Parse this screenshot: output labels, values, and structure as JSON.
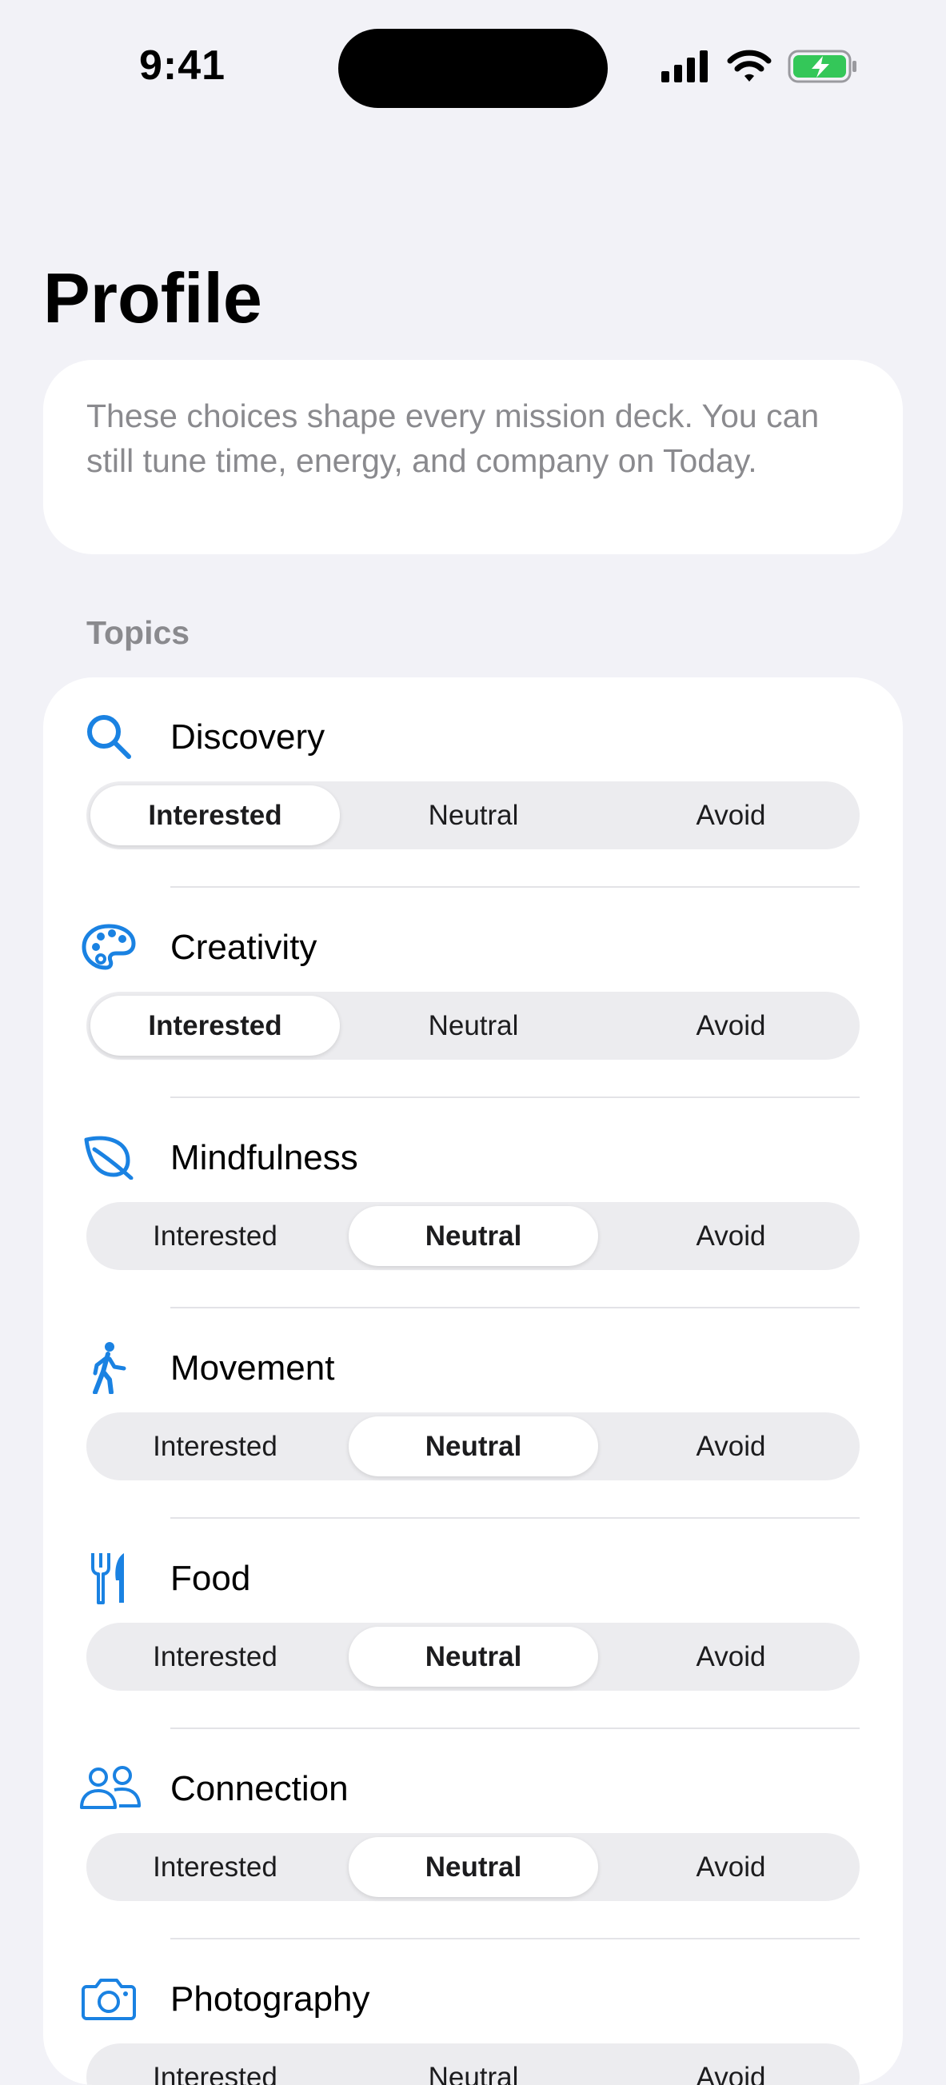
{
  "status_bar": {
    "time": "9:41"
  },
  "page": {
    "title": "Profile",
    "intro": "These choices shape every mission deck. You can still tune time, energy, and company on Today."
  },
  "topics_section": {
    "header": "Topics",
    "options": [
      "Interested",
      "Neutral",
      "Avoid"
    ],
    "items": [
      {
        "name": "Discovery",
        "icon": "magnifying-glass-icon",
        "selected": "Interested"
      },
      {
        "name": "Creativity",
        "icon": "palette-icon",
        "selected": "Interested"
      },
      {
        "name": "Mindfulness",
        "icon": "leaf-icon",
        "selected": "Neutral"
      },
      {
        "name": "Movement",
        "icon": "walking-figure-icon",
        "selected": "Neutral"
      },
      {
        "name": "Food",
        "icon": "fork-knife-icon",
        "selected": "Neutral"
      },
      {
        "name": "Connection",
        "icon": "two-people-icon",
        "selected": "Neutral"
      },
      {
        "name": "Photography",
        "icon": "camera-icon",
        "selected": null
      }
    ]
  },
  "colors": {
    "accent": "#1a82e2",
    "battery": "#34c759",
    "background": "#f2f2f7"
  }
}
